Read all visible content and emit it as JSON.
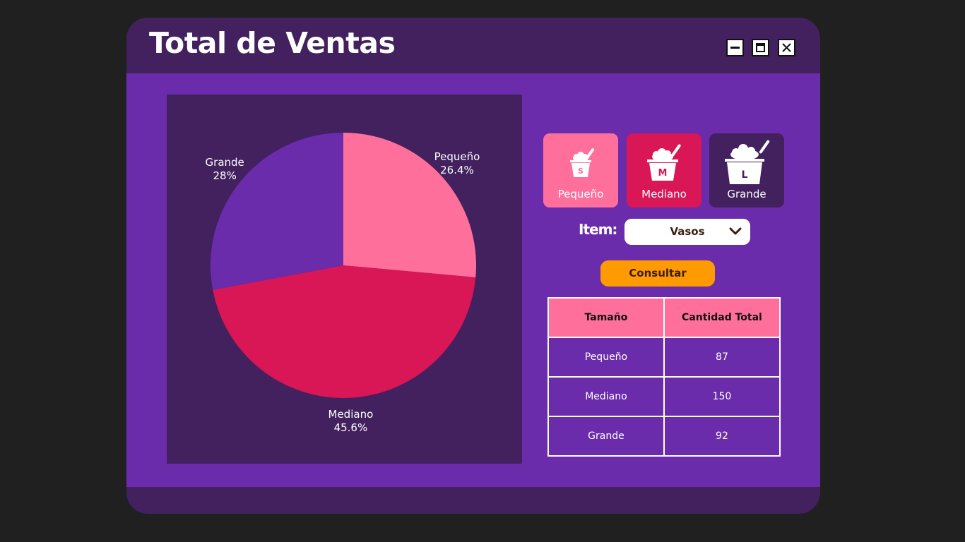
{
  "window": {
    "title": "Total de Ventas",
    "controls": [
      "minimize-icon",
      "maximize-icon",
      "close-icon"
    ]
  },
  "colors": {
    "background": "#202020",
    "window_dark": "#42215e",
    "window_body": "#6a2cab",
    "pequeno": "#ff6f9c",
    "mediano": "#d91656",
    "grande": "#6a2cab",
    "button": "#ff9a00"
  },
  "size_cards": [
    {
      "label": "Pequeño",
      "badge": "S",
      "icon": "ice-cream-cup-small-icon",
      "color": "#ff6f9c"
    },
    {
      "label": "Mediano",
      "badge": "M",
      "icon": "ice-cream-cup-medium-icon",
      "color": "#d91656"
    },
    {
      "label": "Grande",
      "badge": "L",
      "icon": "ice-cream-cup-large-icon",
      "color": "#42215e"
    }
  ],
  "filter": {
    "item_label": "Item:",
    "selected": "Vasos"
  },
  "consult_button": "Consultar",
  "table": {
    "headers": [
      "Tamaño",
      "Cantidad Total"
    ],
    "rows": [
      [
        "Pequeño",
        "87"
      ],
      [
        "Mediano",
        "150"
      ],
      [
        "Grande",
        "92"
      ]
    ]
  },
  "chart_data": {
    "type": "pie",
    "categories": [
      "Pequeño",
      "Mediano",
      "Grande"
    ],
    "values": [
      87,
      150,
      92
    ],
    "percent_labels": [
      "26.4%",
      "45.6%",
      "28%"
    ],
    "colors": [
      "#ff6f9c",
      "#d91656",
      "#6a2cab"
    ]
  }
}
